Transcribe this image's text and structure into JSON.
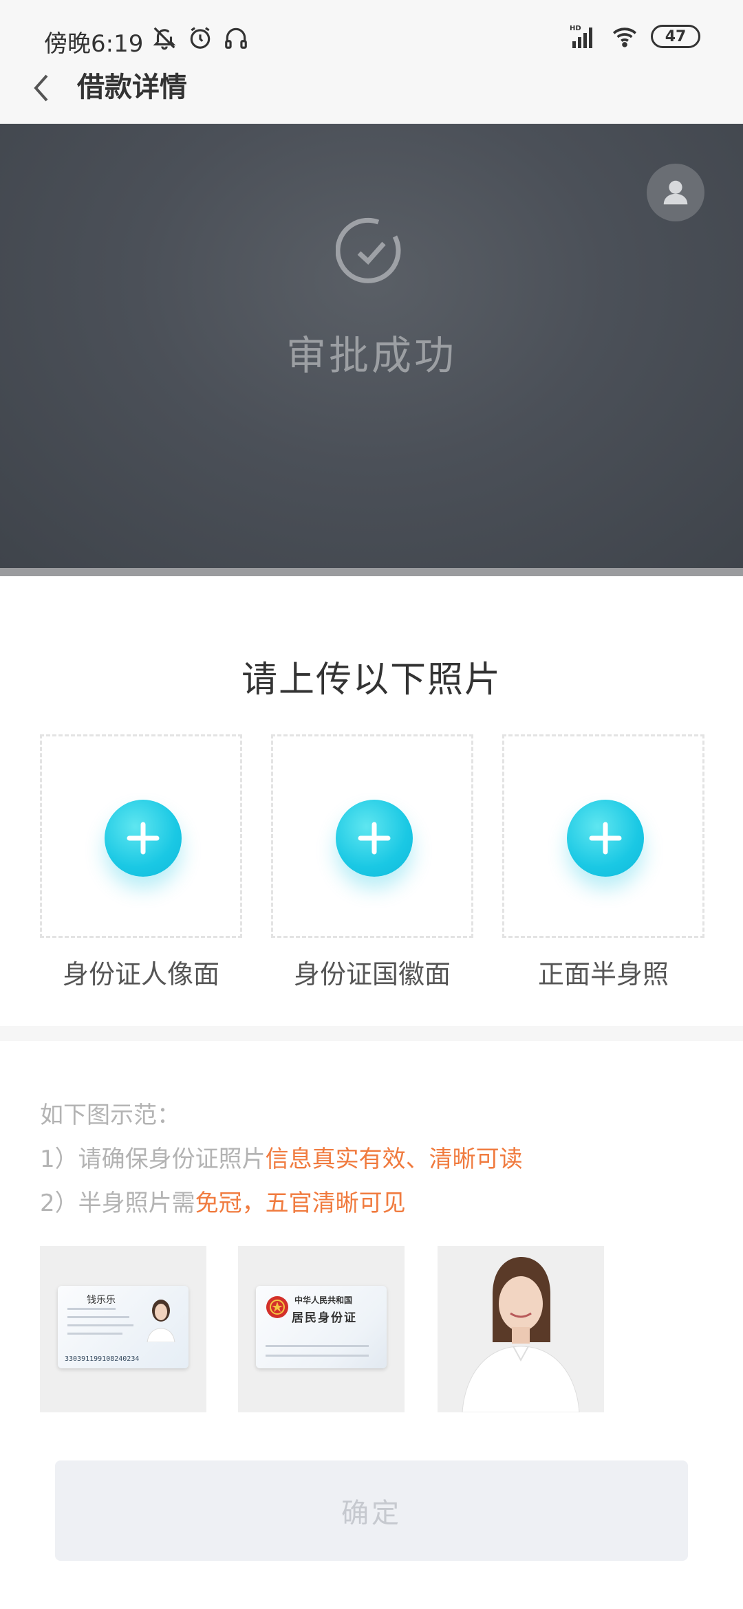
{
  "status_bar": {
    "time": "傍晚6:19",
    "signal_label": "HD",
    "battery": "47",
    "icons": [
      "bell-off-icon",
      "alarm-icon",
      "headphones-icon",
      "signal-icon",
      "wifi-icon",
      "battery-icon"
    ]
  },
  "nav": {
    "title": "借款详情",
    "back_icon": "chevron-left-icon"
  },
  "hero": {
    "status_text": "审批成功",
    "icon": "check-circle-icon",
    "avatar_icon": "user-icon"
  },
  "upload": {
    "title": "请上传以下照片",
    "items": [
      {
        "label": "身份证人像面"
      },
      {
        "label": "身份证国徽面"
      },
      {
        "label": "正面半身照"
      }
    ]
  },
  "instructions": {
    "heading": "如下图示范：",
    "line1_prefix": "1）请确保身份证照片",
    "line1_highlight": "信息真实有效、清晰可读",
    "line2_prefix": "2）半身照片需",
    "line2_highlight": "免冠，五官清晰可见"
  },
  "samples": {
    "id_front": {
      "name": "钱乐乐",
      "number": "330391199108240234"
    },
    "id_back": {
      "title_small": "中华人民共和国",
      "title_large": "居民身份证"
    }
  },
  "confirm": {
    "label": "确定"
  },
  "colors": {
    "accent": "#1ac8e4",
    "highlight": "#f07b3f",
    "hero_bg": "#4b5058"
  }
}
